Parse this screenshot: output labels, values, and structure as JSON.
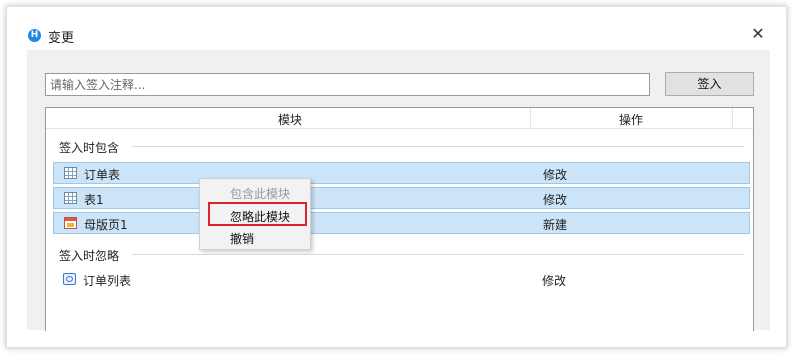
{
  "dialog": {
    "title": "变更",
    "app_icon_letter": "H",
    "close_glyph": "✕"
  },
  "comment": {
    "placeholder": "请输入签入注释...",
    "value": ""
  },
  "checkin_button": "签入",
  "table": {
    "col_module": "模块",
    "col_action": "操作"
  },
  "groups": {
    "include": "签入时包含",
    "ignore": "签入时忽略"
  },
  "rows_included": [
    {
      "name": "订单表",
      "action": "修改",
      "icon": "table-icon"
    },
    {
      "name": "表1",
      "action": "修改",
      "icon": "table-icon"
    },
    {
      "name": "母版页1",
      "action": "新建",
      "icon": "master-page-icon"
    }
  ],
  "rows_ignored": [
    {
      "name": "订单列表",
      "action": "修改",
      "icon": "list-icon"
    }
  ],
  "context_menu": {
    "items": [
      "包含此模块",
      "忽略此模块",
      "撤销"
    ],
    "disabled_index": 0,
    "highlighted_index": 1,
    "highlight_color": "#d9232f"
  },
  "colors": {
    "selection": "#cce4f7",
    "selection_border": "#99c9ef",
    "accent": "#1e88e5"
  }
}
